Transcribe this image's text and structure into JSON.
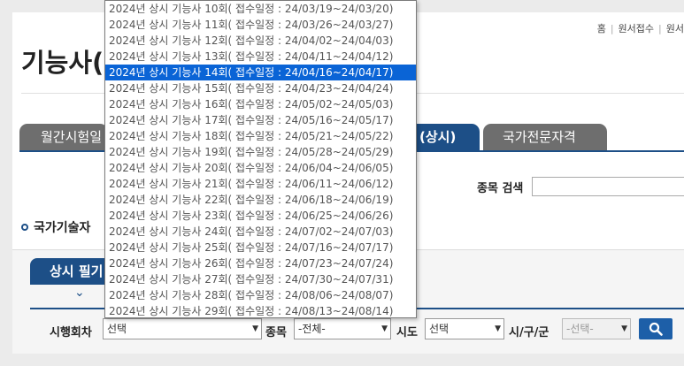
{
  "util_links": [
    "홈",
    "원서접수",
    "원서"
  ],
  "page_title": "기능사(",
  "tabs": [
    {
      "label": "월간시험일",
      "active": false
    },
    {
      "label": "(상시)",
      "active": true
    },
    {
      "label": "국가전문자격",
      "active": false
    }
  ],
  "search": {
    "label": "종목 검색",
    "value": ""
  },
  "section_title": "국가기술자",
  "subtab_label": "상시 필기",
  "filters": {
    "round_label": "시행회차",
    "round_value": "선택",
    "item_label": "종목",
    "item_value": "-전체-",
    "sido_label": "시도",
    "sido_value": "선택",
    "sigungu_label": "시/구/군",
    "sigungu_value": "-선택-"
  },
  "dropdown": {
    "selected_index": 4,
    "options": [
      "2024년 상시 기능사 10회( 접수일정 : 24/03/19~24/03/20)",
      "2024년 상시 기능사 11회( 접수일정 : 24/03/26~24/03/27)",
      "2024년 상시 기능사 12회( 접수일정 : 24/04/02~24/04/03)",
      "2024년 상시 기능사 13회( 접수일정 : 24/04/11~24/04/12)",
      "2024년 상시 기능사 14회( 접수일정 : 24/04/16~24/04/17)",
      "2024년 상시 기능사 15회( 접수일정 : 24/04/23~24/04/24)",
      "2024년 상시 기능사 16회( 접수일정 : 24/05/02~24/05/03)",
      "2024년 상시 기능사 17회( 접수일정 : 24/05/16~24/05/17)",
      "2024년 상시 기능사 18회( 접수일정 : 24/05/21~24/05/22)",
      "2024년 상시 기능사 19회( 접수일정 : 24/05/28~24/05/29)",
      "2024년 상시 기능사 20회( 접수일정 : 24/06/04~24/06/05)",
      "2024년 상시 기능사 21회( 접수일정 : 24/06/11~24/06/12)",
      "2024년 상시 기능사 22회( 접수일정 : 24/06/18~24/06/19)",
      "2024년 상시 기능사 23회( 접수일정 : 24/06/25~24/06/26)",
      "2024년 상시 기능사 24회( 접수일정 : 24/07/02~24/07/03)",
      "2024년 상시 기능사 25회( 접수일정 : 24/07/16~24/07/17)",
      "2024년 상시 기능사 26회( 접수일정 : 24/07/23~24/07/24)",
      "2024년 상시 기능사 27회( 접수일정 : 24/07/30~24/07/31)",
      "2024년 상시 기능사 28회( 접수일정 : 24/08/06~24/08/07)",
      "2024년 상시 기능사 29회( 접수일정 : 24/08/13~24/08/14)"
    ]
  },
  "colors": {
    "brand_blue": "#1d4f87",
    "highlight": "#0a64d6"
  }
}
